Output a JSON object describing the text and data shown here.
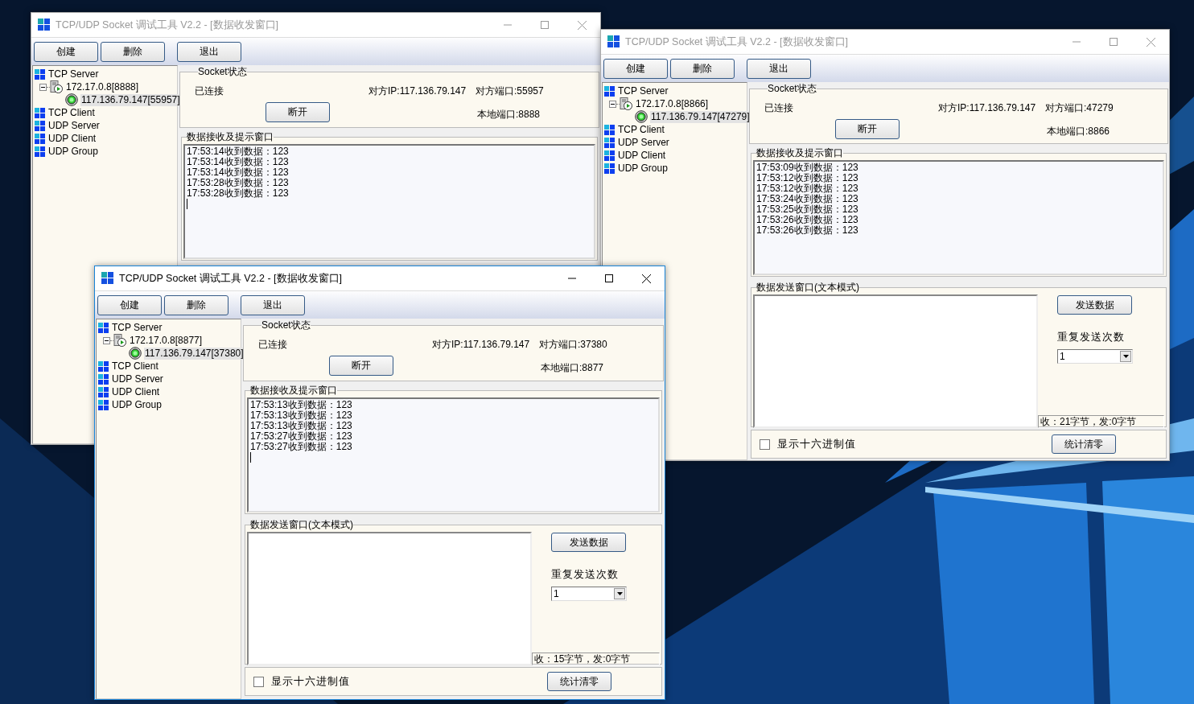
{
  "windows": [
    {
      "title": "TCP/UDP Socket 调试工具 V2.2 - [数据收发窗口]",
      "active": false,
      "toolbar": [
        "创建",
        "删除",
        "退出"
      ],
      "tree": [
        {
          "kind": "category",
          "label": "TCP Server",
          "selected": false,
          "children": [
            {
              "kind": "server",
              "label": "172.17.0.8[8888]",
              "selected": false,
              "expanded": true,
              "children": [
                {
                  "kind": "client",
                  "label": "117.136.79.147[55957]",
                  "selected": true
                }
              ]
            }
          ]
        },
        {
          "kind": "category",
          "label": "TCP Client",
          "selected": false
        },
        {
          "kind": "category",
          "label": "UDP Server",
          "selected": false
        },
        {
          "kind": "category",
          "label": "UDP Client",
          "selected": false
        },
        {
          "kind": "category",
          "label": "UDP Group",
          "selected": false
        }
      ],
      "socket": {
        "title": "Socket状态",
        "status": "已连接",
        "peer_ip": "对方IP:117.136.79.147",
        "peer_port": "对方端口:55957",
        "button": "断开",
        "local_port": "本地端口:8888"
      },
      "receive": {
        "title": "数据接收及提示窗口",
        "cursor": true,
        "lines": [
          "17:53:14收到数据：123",
          "17:53:14收到数据：123",
          "17:53:14收到数据：123",
          "17:53:28收到数据：123",
          "17:53:28收到数据：123"
        ]
      }
    },
    {
      "title": "TCP/UDP Socket 调试工具 V2.2 - [数据收发窗口]",
      "active": false,
      "toolbar": [
        "创建",
        "删除",
        "退出"
      ],
      "tree": [
        {
          "kind": "category",
          "label": "TCP Server",
          "selected": false,
          "children": [
            {
              "kind": "server",
              "label": "172.17.0.8[8866]",
              "selected": false,
              "expanded": true,
              "children": [
                {
                  "kind": "client",
                  "label": "117.136.79.147[47279]",
                  "selected": true
                }
              ]
            }
          ]
        },
        {
          "kind": "category",
          "label": "TCP Client",
          "selected": false
        },
        {
          "kind": "category",
          "label": "UDP Server",
          "selected": false
        },
        {
          "kind": "category",
          "label": "UDP Client",
          "selected": false
        },
        {
          "kind": "category",
          "label": "UDP Group",
          "selected": false
        }
      ],
      "socket": {
        "title": "Socket状态",
        "status": "已连接",
        "peer_ip": "对方IP:117.136.79.147",
        "peer_port": "对方端口:47279",
        "button": "断开",
        "local_port": "本地端口:8866"
      },
      "receive": {
        "title": "数据接收及提示窗口",
        "lines": [
          "17:53:09收到数据：123",
          "17:53:12收到数据：123",
          "17:53:12收到数据：123",
          "17:53:24收到数据：123",
          "17:53:25收到数据：123",
          "17:53:26收到数据：123",
          "17:53:26收到数据：123"
        ]
      },
      "send": {
        "title": "数据发送窗口(文本模式)",
        "send_button": "发送数据",
        "repeat_label": "重复发送次数",
        "repeat_value": "1",
        "stats": "收：21字节，发:0字节",
        "hex_checkbox": {
          "label": "显示十六进制值",
          "checked": false
        },
        "clear_button": "统计清零"
      }
    },
    {
      "title": "TCP/UDP Socket 调试工具 V2.2 - [数据收发窗口]",
      "active": true,
      "toolbar": [
        "创建",
        "删除",
        "退出"
      ],
      "tree": [
        {
          "kind": "category",
          "label": "TCP Server",
          "selected": false,
          "children": [
            {
              "kind": "server",
              "label": "172.17.0.8[8877]",
              "selected": false,
              "expanded": true,
              "children": [
                {
                  "kind": "client",
                  "label": "117.136.79.147[37380]",
                  "selected": true
                }
              ]
            }
          ]
        },
        {
          "kind": "category",
          "label": "TCP Client",
          "selected": false
        },
        {
          "kind": "category",
          "label": "UDP Server",
          "selected": false
        },
        {
          "kind": "category",
          "label": "UDP Client",
          "selected": false
        },
        {
          "kind": "category",
          "label": "UDP Group",
          "selected": false
        }
      ],
      "socket": {
        "title": "Socket状态",
        "status": "已连接",
        "peer_ip": "对方IP:117.136.79.147",
        "peer_port": "对方端口:37380",
        "button": "断开",
        "local_port": "本地端口:8877"
      },
      "receive": {
        "title": "数据接收及提示窗口",
        "cursor": true,
        "lines": [
          "17:53:13收到数据：123",
          "17:53:13收到数据：123",
          "17:53:13收到数据：123",
          "17:53:27收到数据：123",
          "17:53:27收到数据：123"
        ]
      },
      "send": {
        "title": "数据发送窗口(文本模式)",
        "send_button": "发送数据",
        "repeat_label": "重复发送次数",
        "repeat_value": "1",
        "stats": "收：15字节，发:0字节",
        "hex_checkbox": {
          "label": "显示十六进制值",
          "checked": false
        },
        "clear_button": "统计清零"
      }
    }
  ]
}
